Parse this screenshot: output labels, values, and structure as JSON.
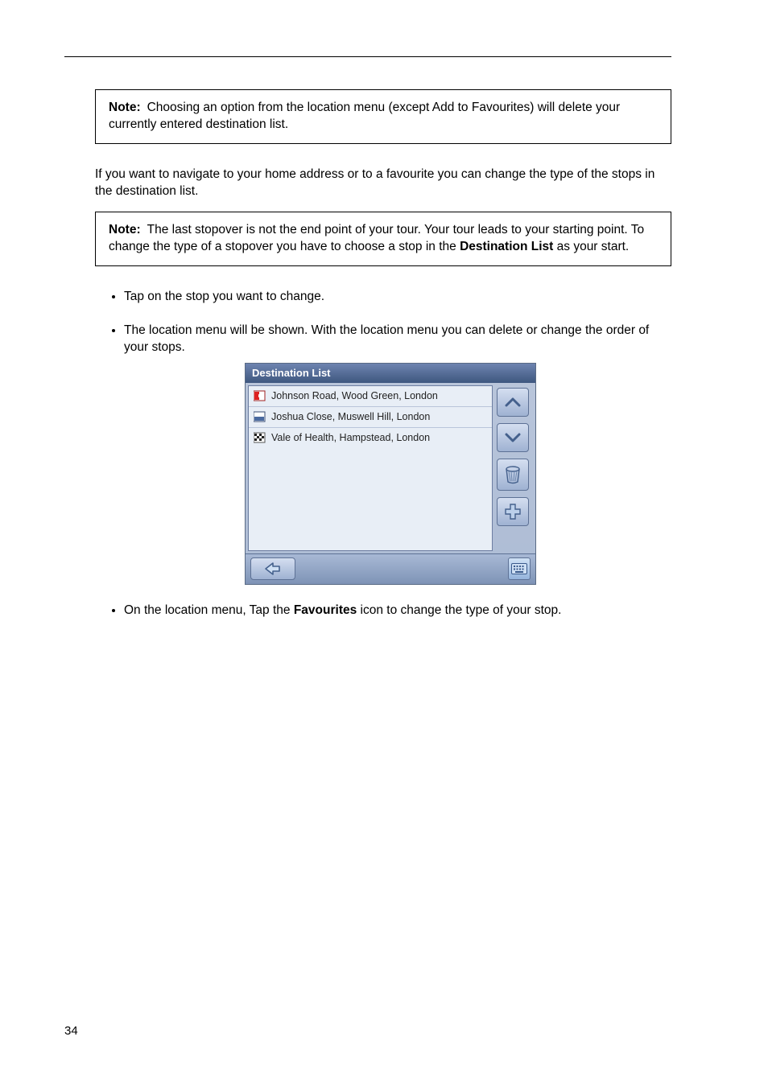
{
  "noteBox1": {
    "label": "Note:",
    "text": "Choosing an option from the location menu (except Add to Favourites) will delete your currently entered destination list."
  },
  "intro": "If you want to navigate to your home address or to a favourite you can change the type of the stops in the destination list.",
  "noteBox2": {
    "label": "Note:",
    "text_a": "The last stopover is not the end point of your tour. Your tour leads to your starting point. To change the type of a stopover you have to",
    "text_b_pre": "choose a stop in the",
    "text_b_bold": "Destination List",
    "text_b_post": "as your start."
  },
  "bullets": {
    "b1": "Tap on the stop you want to change.",
    "b2": "The location menu will be shown. With the location menu you can delete or change the order of your stops."
  },
  "device": {
    "title": "Destination List",
    "rows": [
      {
        "icon": "start-icon",
        "label": "Johnson Road, Wood Green, London"
      },
      {
        "icon": "waypoint-icon",
        "label": "Joshua Close, Muswell Hill, London"
      },
      {
        "icon": "finish-icon",
        "label": "Vale of Health, Hampstead, London"
      }
    ]
  },
  "bullets2": {
    "b3_pre": "On the location menu, Tap the",
    "b3_bold": "Favourites",
    "b3_post": "icon to change the type of your stop."
  },
  "pageNum": "34"
}
